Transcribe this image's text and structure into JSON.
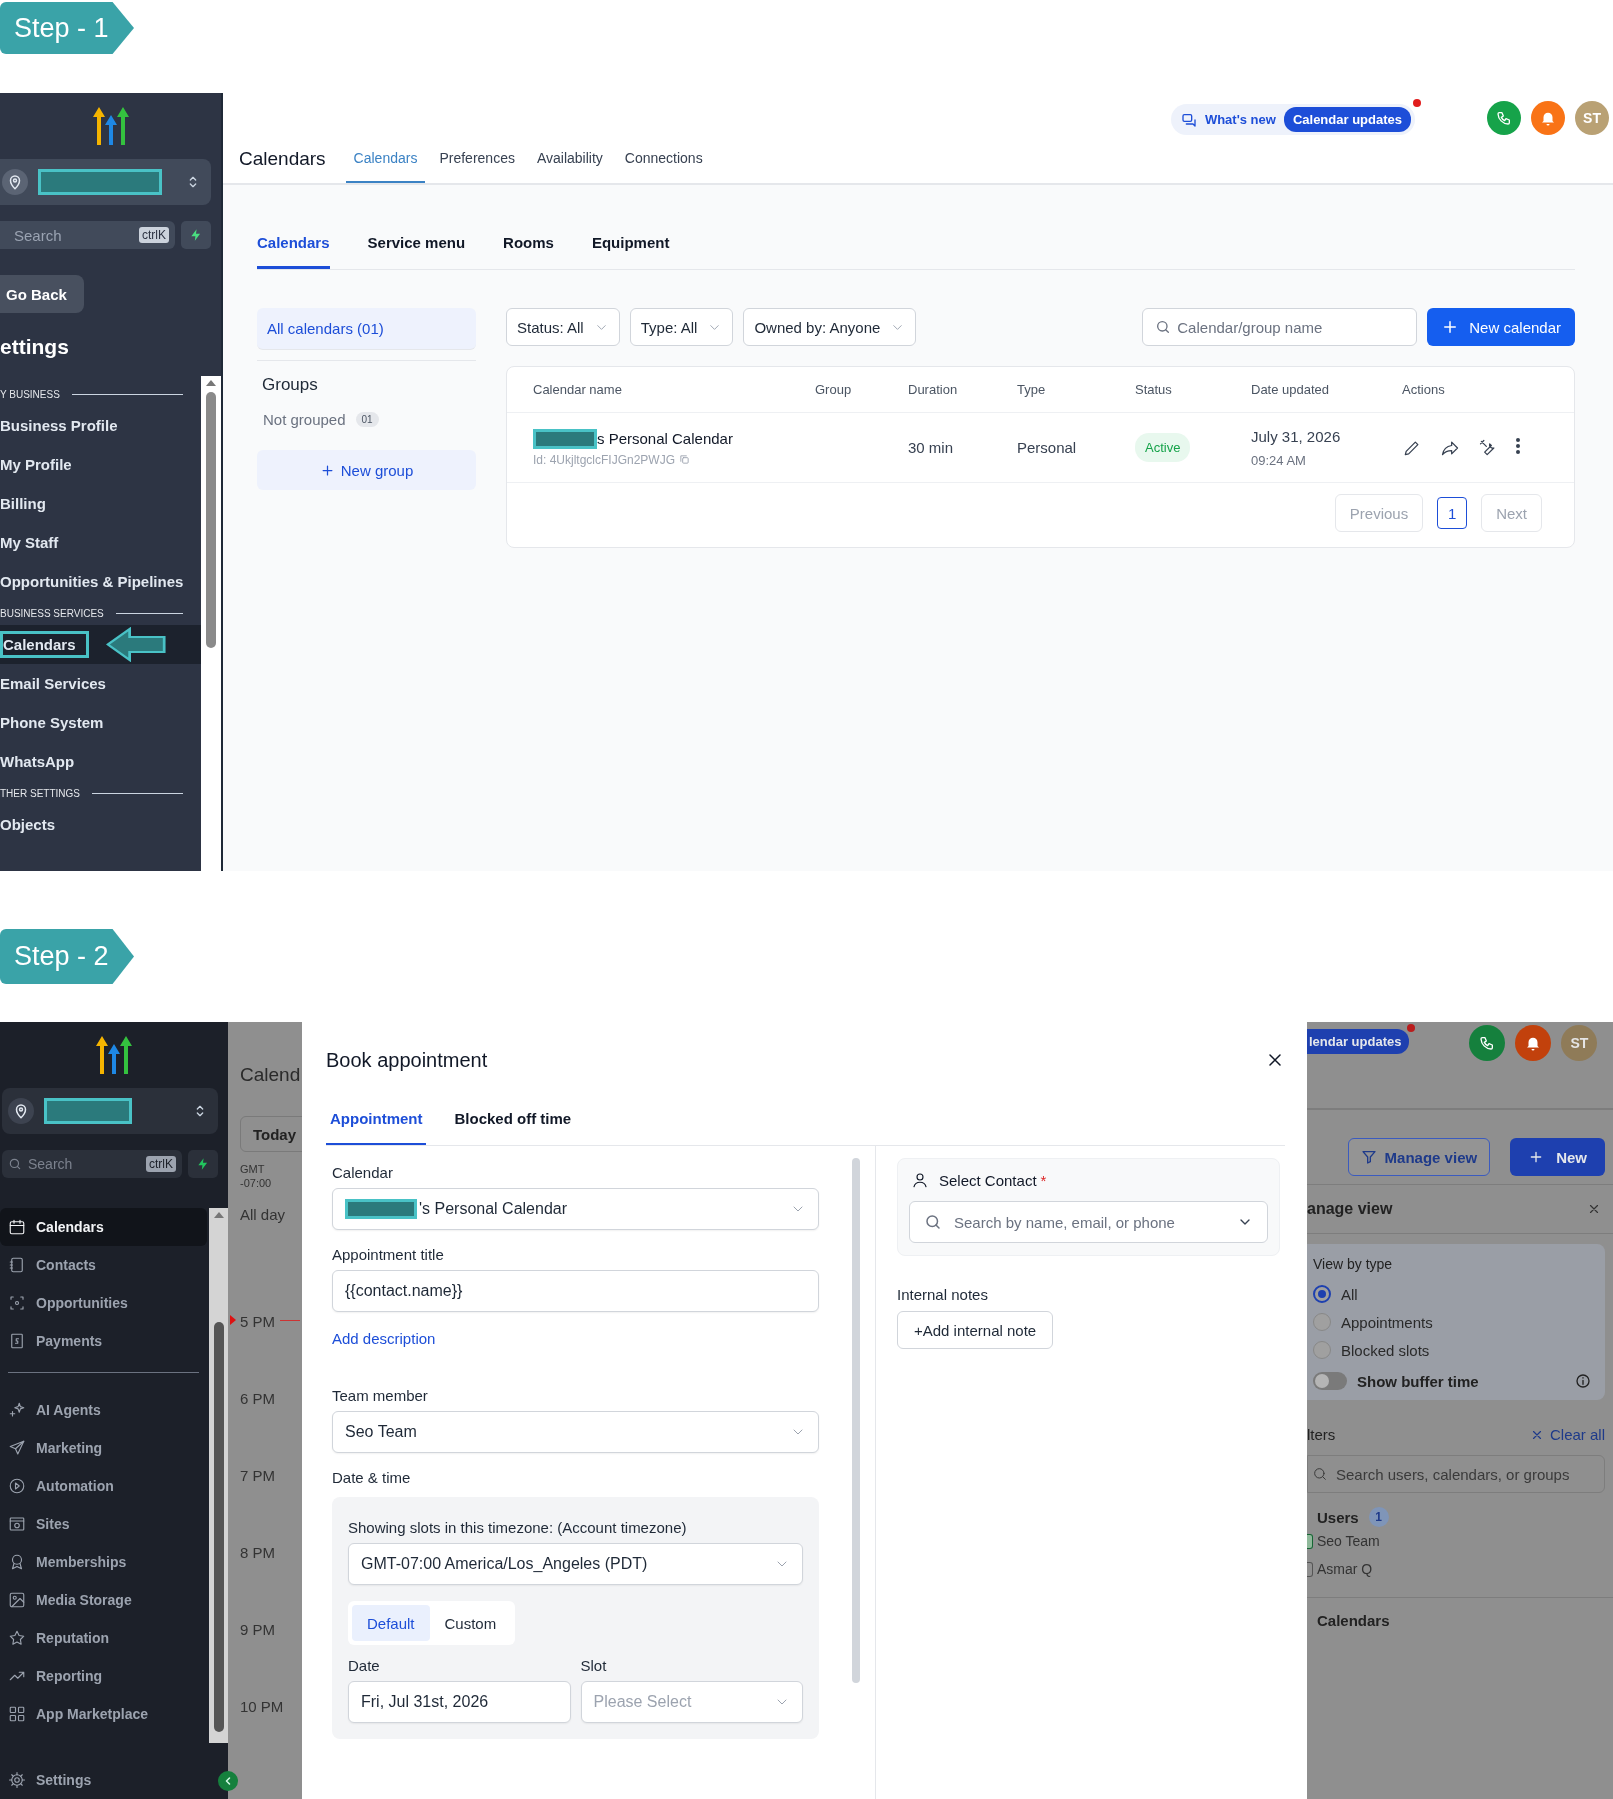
{
  "step1": {
    "badge": "Step - 1",
    "sidebar": {
      "search_placeholder": "Search",
      "shortcut": "ctrlK",
      "back": "Go Back",
      "heading": "ettings",
      "sections": [
        {
          "title": "Y BUSINESS",
          "items": [
            {
              "label": "Business Profile",
              "selected": false
            },
            {
              "label": "My Profile",
              "selected": false
            },
            {
              "label": "Billing",
              "selected": false
            },
            {
              "label": "My Staff",
              "selected": false
            },
            {
              "label": "Opportunities & Pipelines",
              "selected": false
            }
          ]
        },
        {
          "title": "BUSINESS SERVICES",
          "items": [
            {
              "label": "Calendars",
              "selected": true
            },
            {
              "label": "Email Services",
              "selected": false
            },
            {
              "label": "Phone System",
              "selected": false
            },
            {
              "label": "WhatsApp",
              "selected": false
            }
          ]
        },
        {
          "title": "THER SETTINGS",
          "items": [
            {
              "label": "Objects",
              "selected": false
            }
          ]
        }
      ]
    },
    "header": {
      "whats_new": "What's new",
      "updates": "Calendar updates",
      "avatar": "ST",
      "title": "Calendars",
      "tabs": [
        {
          "label": "Calendars",
          "selected": true
        },
        {
          "label": "Preferences",
          "selected": false
        },
        {
          "label": "Availability",
          "selected": false
        },
        {
          "label": "Connections",
          "selected": false
        }
      ]
    },
    "subtabs": [
      {
        "label": "Calendars",
        "selected": true
      },
      {
        "label": "Service menu",
        "selected": false
      },
      {
        "label": "Rooms",
        "selected": false
      },
      {
        "label": "Equipment",
        "selected": false
      }
    ],
    "groups": {
      "all": "All calendars (01)",
      "heading": "Groups",
      "not_grouped": "Not grouped",
      "count": "01",
      "new_group": "New group"
    },
    "filters": [
      "Status: All",
      "Type: All",
      "Owned by: Anyone"
    ],
    "search_placeholder": "Calendar/group name",
    "new_calendar": "New calendar",
    "table": {
      "columns": [
        "Calendar name",
        "Group",
        "Duration",
        "Type",
        "Status",
        "Date updated",
        "Actions"
      ],
      "rows": [
        {
          "name": "s Personal Calendar",
          "id": "Id: 4UkjltgclcFIJGn2PWJG",
          "duration": "30 min",
          "type": "Personal",
          "status": "Active",
          "date": "July 31, 2026",
          "time": "09:24 AM"
        }
      ]
    },
    "pagination": {
      "previous": "Previous",
      "pages": [
        {
          "label": "1",
          "selected": true
        }
      ],
      "next": "Next"
    }
  },
  "step2": {
    "badge": "Step - 2",
    "sidebar": {
      "search_placeholder": "Search",
      "shortcut": "ctrlK",
      "items": [
        {
          "label": "Calendars",
          "selected": true
        },
        {
          "label": "Contacts",
          "selected": false
        },
        {
          "label": "Opportunities",
          "selected": false
        },
        {
          "label": "Payments",
          "selected": false
        }
      ],
      "more_items": [
        {
          "label": "AI Agents",
          "selected": false
        },
        {
          "label": "Marketing",
          "selected": false
        },
        {
          "label": "Automation",
          "selected": false
        },
        {
          "label": "Sites",
          "selected": false
        },
        {
          "label": "Memberships",
          "selected": false
        },
        {
          "label": "Media Storage",
          "selected": false
        },
        {
          "label": "Reputation",
          "selected": false
        },
        {
          "label": "Reporting",
          "selected": false
        },
        {
          "label": "App Marketplace",
          "selected": false
        }
      ],
      "settings": "Settings"
    },
    "background": {
      "title": "Calend",
      "today": "Today",
      "timezone": [
        "GMT",
        "-07:00"
      ],
      "all_day": "All day",
      "hours": [
        "5 PM",
        "6 PM",
        "7 PM",
        "8 PM",
        "9 PM",
        "10 PM"
      ],
      "updates": "lendar updates",
      "avatar": "ST",
      "manage_view": "Manage view",
      "new": "New",
      "panel_title": "anage view",
      "view_by_type": "View by type",
      "types": [
        {
          "label": "All",
          "selected": true
        },
        {
          "label": "Appointments",
          "selected": false
        },
        {
          "label": "Blocked slots",
          "selected": false
        }
      ],
      "buffer": {
        "label": "Show buffer time",
        "on": false
      },
      "filters": "lters",
      "clear_all": "Clear all",
      "search_placeholder": "Search users, calendars, or groups",
      "users": {
        "label": "Users",
        "count": "1",
        "items": [
          {
            "label": "Seo Team",
            "checked": true
          },
          {
            "label": "Asmar Q",
            "checked": false
          }
        ]
      },
      "calendars": "Calendars"
    },
    "modal": {
      "title": "Book appointment",
      "tabs": [
        {
          "label": "Appointment",
          "selected": true
        },
        {
          "label": "Blocked off time",
          "selected": false
        }
      ],
      "calendar_label": "Calendar",
      "calendar_value": "'s Personal Calendar",
      "title_label": "Appointment title",
      "title_value": "{{contact.name}}",
      "add_description": "Add description",
      "member_label": "Team member",
      "member_value": "Seo Team",
      "datetime_label": "Date & time",
      "timezone_label": "Showing slots in this timezone: (Account timezone)",
      "timezone_value": "GMT-07:00 America/Los_Angeles (PDT)",
      "modes": [
        {
          "label": "Default",
          "selected": true
        },
        {
          "label": "Custom",
          "selected": false
        }
      ],
      "date_label": "Date",
      "date_value": "Fri, Jul 31st, 2026",
      "slot_label": "Slot",
      "slot_placeholder": "Please Select",
      "contact_label": "Select Contact",
      "required": "*",
      "contact_placeholder": "Search by name, email, or phone",
      "notes_label": "Internal notes",
      "add_note": "+Add internal note"
    }
  }
}
